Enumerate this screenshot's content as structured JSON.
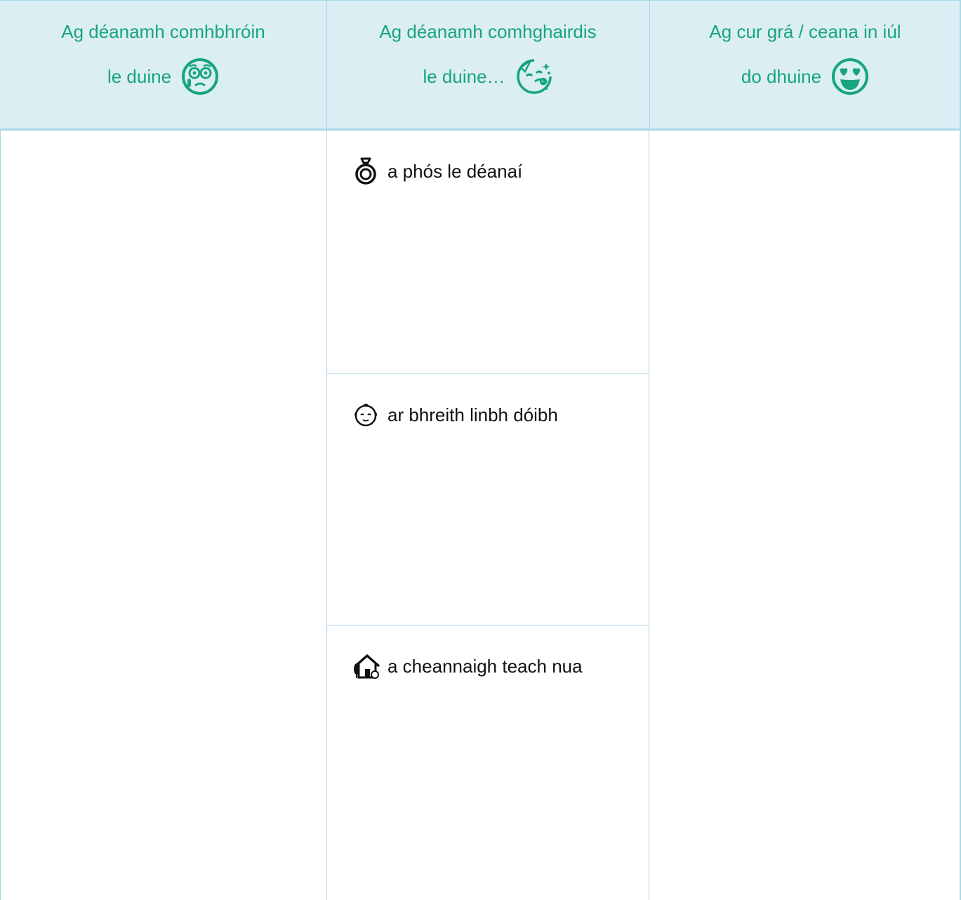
{
  "header": {
    "columns": [
      {
        "line1": "Ag déanamh comhbhróin",
        "line2": "le duine",
        "icon": "sad-face-icon"
      },
      {
        "line1": "Ag déanamh comhghairdis",
        "line2": "le duine…",
        "icon": "party-face-icon"
      },
      {
        "line1": "Ag cur grá / ceana in iúl",
        "line2": "do dhuine",
        "icon": "heart-eyes-face-icon"
      }
    ]
  },
  "middle": {
    "items": [
      {
        "text": "a phós le déanaí",
        "icon": "ring-icon"
      },
      {
        "text": "ar bhreith linbh dóibh",
        "icon": "baby-icon"
      },
      {
        "text": "a cheannaigh teach nua",
        "icon": "house-icon"
      }
    ]
  },
  "colors": {
    "header_text": "#16a57e",
    "header_bg": "#dbeef4",
    "border": "#a9d8e6"
  }
}
